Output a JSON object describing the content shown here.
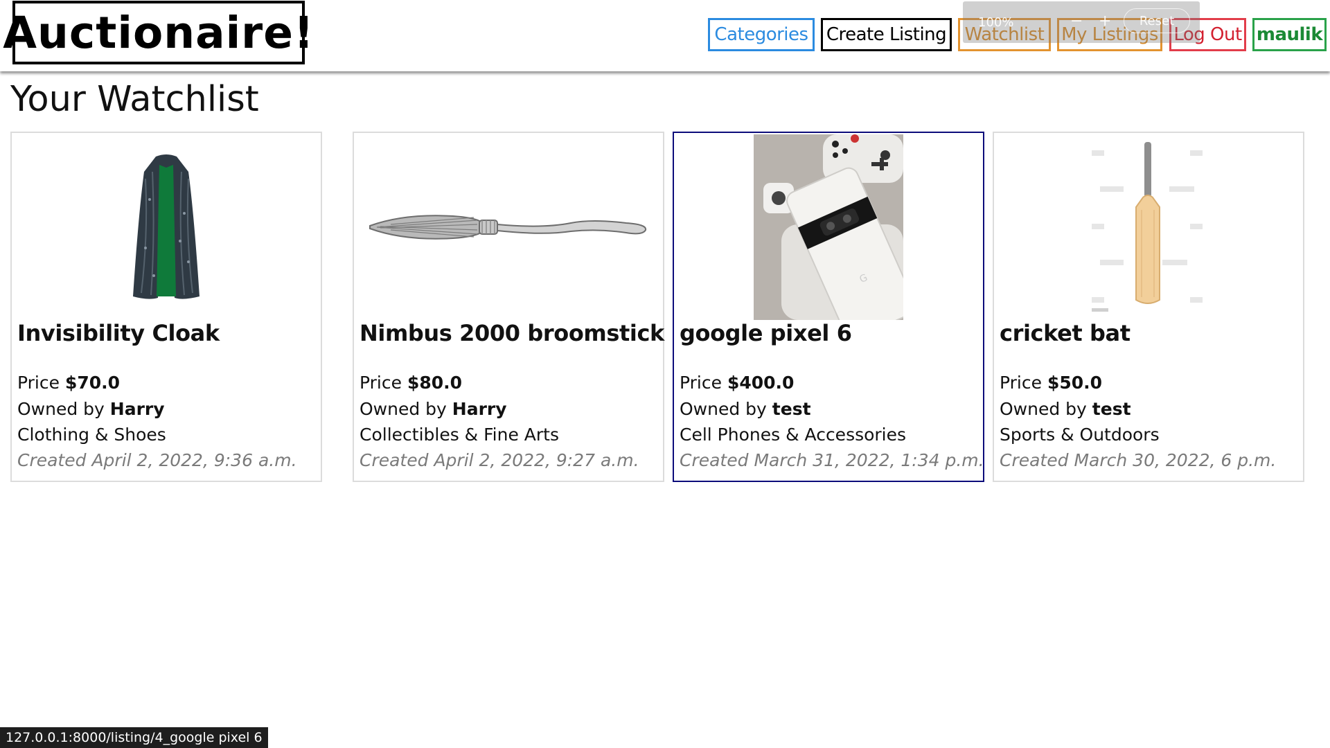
{
  "header": {
    "brand": "Auctionaire!",
    "nav": {
      "categories": "Categories",
      "create_listing": "Create Listing",
      "watchlist": "Watchlist",
      "my_listings": "My Listings",
      "log_out": "Log Out",
      "user": "maulik"
    },
    "colors": {
      "categories": "#2b8be0",
      "create_listing": "#000000",
      "watchlist": "#e3932f",
      "my_listings": "#e3932f",
      "log_out": "#e23d4a",
      "user": "#2aa24a"
    }
  },
  "zoom": {
    "level": "100%",
    "minus": "−",
    "plus": "+",
    "reset": "Reset"
  },
  "main": {
    "title": "Your Watchlist",
    "labels": {
      "price": "Price",
      "owned_by": "Owned by",
      "created": "Created"
    },
    "listings": [
      {
        "title": "Invisibility Cloak",
        "price": "$70.0",
        "owner": "Harry",
        "category": "Clothing & Shoes",
        "created": "April 2, 2022, 9:36 a.m.",
        "image": "cloak"
      },
      {
        "title": "Nimbus 2000 broomstick",
        "price": "$80.0",
        "owner": "Harry",
        "category": "Collectibles & Fine Arts",
        "created": "April 2, 2022, 9:27 a.m.",
        "image": "broomstick"
      },
      {
        "title": "google pixel 6",
        "price": "$400.0",
        "owner": "test",
        "category": "Cell Phones & Accessories",
        "created": "March 31, 2022, 1:34 p.m.",
        "image": "phone",
        "selected": true
      },
      {
        "title": "cricket bat",
        "price": "$50.0",
        "owner": "test",
        "category": "Sports & Outdoors",
        "created": "March 30, 2022, 6 p.m.",
        "image": "cricket-bat"
      }
    ]
  },
  "status_bar": {
    "url": "127.0.0.1:8000/listing/4_google pixel 6"
  }
}
